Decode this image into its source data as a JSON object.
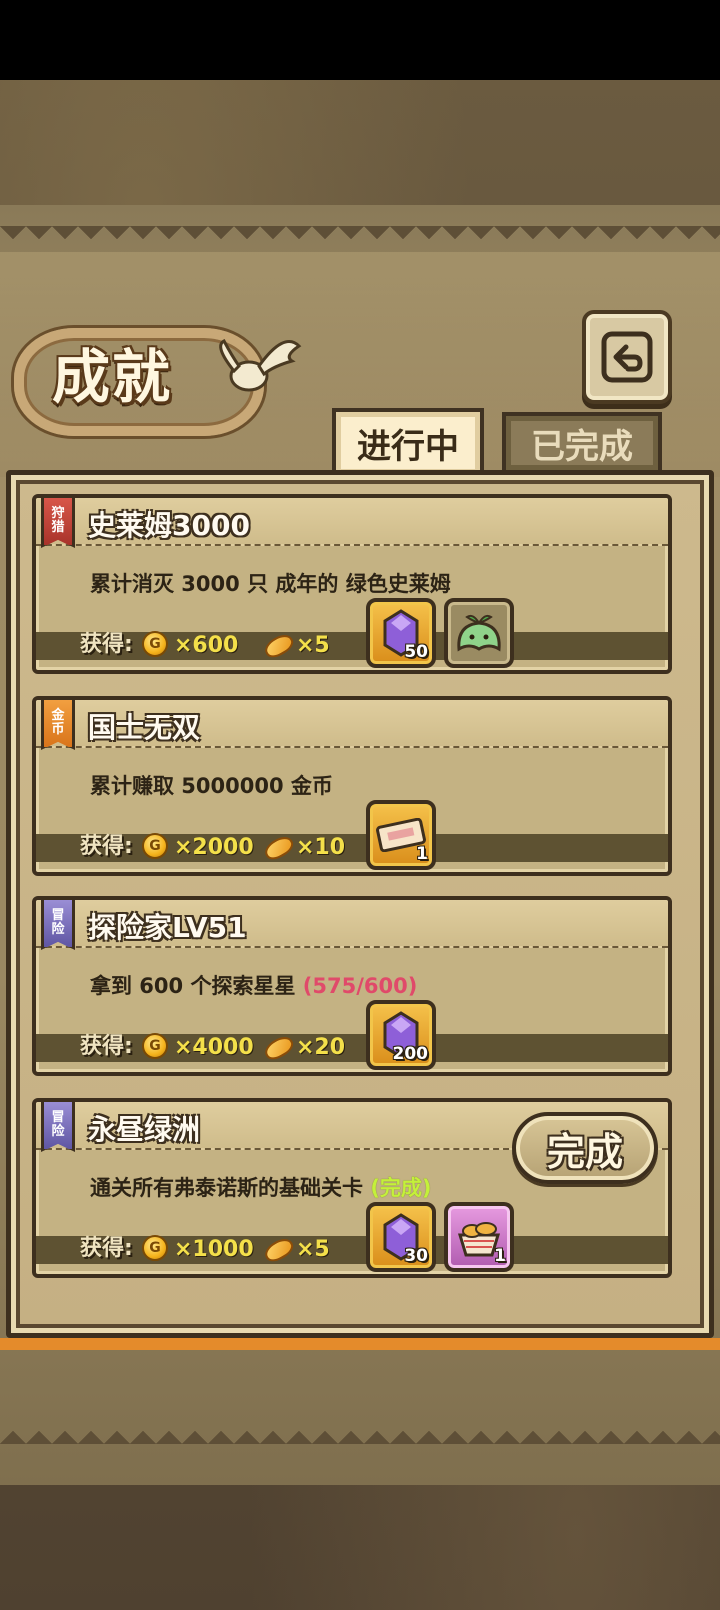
{
  "header": {
    "title": "成就",
    "tabs": [
      {
        "label": "进行中",
        "active": true
      },
      {
        "label": "已完成",
        "active": false
      }
    ]
  },
  "reward_label": "获得:",
  "achievements": [
    {
      "category": "狩猎",
      "category_color": "red",
      "name": "史莱姆3000",
      "desc": "累计消灭 3000 只 成年的 绿色史莱姆",
      "progress": "",
      "gold": "×600",
      "bread": "×5",
      "items": [
        {
          "icon": "purple-crystal-icon",
          "count": "50"
        },
        {
          "icon": "green-slime-icon",
          "count": ""
        }
      ]
    },
    {
      "category": "金币",
      "category_color": "orange",
      "name": "国士无双",
      "desc": "累计赚取 5000000 金币",
      "progress": "",
      "gold": "×2000",
      "bread": "×10",
      "items": [
        {
          "icon": "ticket-icon",
          "count": "1"
        }
      ]
    },
    {
      "category": "冒险",
      "category_color": "purple",
      "name": "探险家LV51",
      "desc": "拿到 600 个探索星星",
      "progress": "(575/600)",
      "gold": "×4000",
      "bread": "×20",
      "items": [
        {
          "icon": "purple-crystal-icon",
          "count": "200"
        }
      ]
    },
    {
      "category": "冒险",
      "category_color": "purple",
      "name": "永昼绿洲",
      "desc": "通关所有弗泰诺斯的基础关卡",
      "progress": "(完成)",
      "gold": "×1000",
      "bread": "×5",
      "items": [
        {
          "icon": "purple-crystal-icon",
          "count": "30"
        },
        {
          "icon": "bread-basket-icon",
          "count": "1"
        }
      ],
      "complete_button": "完成"
    }
  ],
  "gold_symbol": "G",
  "colors": {
    "progress_red": "#e04a6a",
    "complete_green": "#c4f03a",
    "reward_yellow": "#f4e04a"
  }
}
